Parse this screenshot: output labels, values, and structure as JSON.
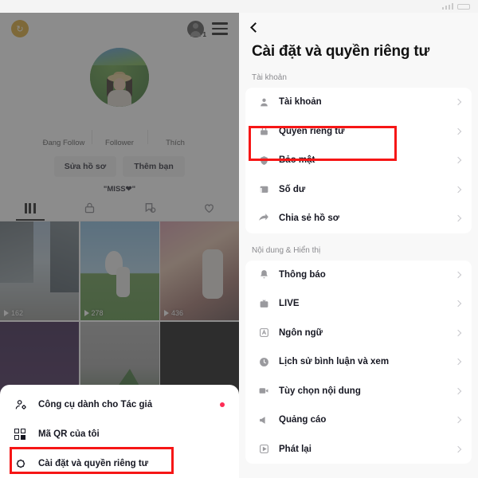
{
  "left_panel": {
    "top_bar": {
      "coin_icon": "coin-icon",
      "username_redacted": "",
      "profile_badge": "1",
      "menu_icon": "hamburger-icon"
    },
    "stats": [
      {
        "label": "Đang Follow",
        "value": ""
      },
      {
        "label": "Follower",
        "value": ""
      },
      {
        "label": "Thích",
        "value": ""
      }
    ],
    "buttons": {
      "edit_profile": "Sửa hồ sơ",
      "add_friend": "Thêm bạn"
    },
    "bio": "\"MISS❤\"",
    "tabs": [
      {
        "name": "videos-tab",
        "icon": "grid-icon",
        "active": true
      },
      {
        "name": "private-tab",
        "icon": "lock-icon",
        "active": false
      },
      {
        "name": "repost-tab",
        "icon": "repost-icon",
        "active": false
      },
      {
        "name": "liked-tab",
        "icon": "heart-icon",
        "active": false
      }
    ],
    "videos": [
      {
        "views": "162"
      },
      {
        "views": "278"
      },
      {
        "views": "436"
      },
      {
        "views": ""
      },
      {
        "views": ""
      },
      {
        "views": ""
      }
    ],
    "bottom_sheet": [
      {
        "label": "Công cụ dành cho Tác giả",
        "icon": "creator-tools-icon",
        "badge": true
      },
      {
        "label": "Mã QR của tôi",
        "icon": "qr-code-icon",
        "badge": false
      },
      {
        "label": "Cài đặt và quyền riêng tư",
        "icon": "gear-icon",
        "badge": false,
        "highlighted": true
      }
    ]
  },
  "right_panel": {
    "back_label": "back-chevron",
    "title": "Cài đặt và quyền riêng tư",
    "sections": [
      {
        "label": "Tài khoản",
        "items": [
          {
            "label": "Tài khoản",
            "icon": "person-icon",
            "highlighted": false
          },
          {
            "label": "Quyền riêng tư",
            "icon": "lock-icon",
            "highlighted": true
          },
          {
            "label": "Bảo mật",
            "icon": "shield-icon",
            "highlighted": false
          },
          {
            "label": "Số dư",
            "icon": "wallet-icon",
            "highlighted": false
          },
          {
            "label": "Chia sẻ hồ sơ",
            "icon": "share-icon",
            "highlighted": false
          }
        ]
      },
      {
        "label": "Nội dung & Hiển thị",
        "items": [
          {
            "label": "Thông báo",
            "icon": "bell-icon",
            "highlighted": false
          },
          {
            "label": "LIVE",
            "icon": "live-icon",
            "highlighted": false
          },
          {
            "label": "Ngôn ngữ",
            "icon": "language-icon",
            "highlighted": false
          },
          {
            "label": "Lịch sử bình luận và xem",
            "icon": "clock-icon",
            "highlighted": false
          },
          {
            "label": "Tùy chọn nội dung",
            "icon": "video-icon",
            "highlighted": false
          },
          {
            "label": "Quảng cáo",
            "icon": "megaphone-icon",
            "highlighted": false
          },
          {
            "label": "Phát lại",
            "icon": "play-icon",
            "highlighted": false
          }
        ]
      }
    ]
  },
  "colors": {
    "highlight": "#f61616",
    "accent_red": "#fe2c55",
    "bg": "#f8f8f8",
    "card": "#ffffff",
    "text": "#161722",
    "muted": "#8a8a8e"
  }
}
